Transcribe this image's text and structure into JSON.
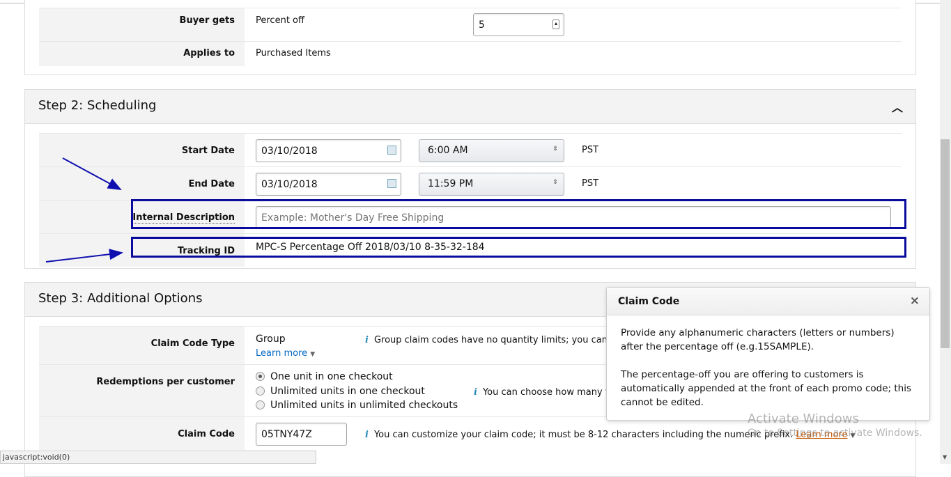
{
  "step1": {
    "rows": [
      {
        "label": "Buyer gets",
        "value": "Percent off",
        "input": "5"
      },
      {
        "label": "Applies to",
        "value": "Purchased Items"
      }
    ]
  },
  "step2": {
    "title": "Step 2: Scheduling",
    "start_label": "Start Date",
    "start_date": "03/10/2018",
    "start_time": "6:00 AM",
    "end_label": "End Date",
    "end_date": "03/10/2018",
    "end_time": "11:59 PM",
    "tz": "PST",
    "desc_label": "Internal Description",
    "desc_placeholder": "Example: Mother's Day Free Shipping",
    "tracking_label": "Tracking ID",
    "tracking_value": "MPC-S Percentage Off 2018/03/10 8-35-32-184"
  },
  "step3": {
    "title": "Step 3: Additional Options",
    "cct_label": "Claim Code Type",
    "cct_value": "Group",
    "learn_more": "Learn more",
    "cct_info": "Group claim codes have no quantity limits; you cannot c",
    "rpc_label": "Redemptions per customer",
    "options": [
      "One unit in one checkout",
      "Unlimited units in one checkout",
      "Unlimited units in unlimited checkouts"
    ],
    "rpc_info": "You can choose how many tir",
    "cc_label": "Claim Code",
    "cc_value": "05TNY47Z",
    "cc_info": "You can customize your claim code; it must be 8-12 characters including the numeric prefix.",
    "cc_learn": "Learn more"
  },
  "tooltip": {
    "title": "Claim Code",
    "close": "×",
    "p1": "Provide any alphanumeric characters (letters or numbers) after the percentage off (e.g.15SAMPLE).",
    "p2": "The percentage-off you are offering to customers is automatically appended at the front of each promo code; this cannot be edited."
  },
  "watermark": {
    "line1": "Activate Windows",
    "line2": "Go to Settings to activate Windows."
  },
  "status": "javascript:void(0)"
}
